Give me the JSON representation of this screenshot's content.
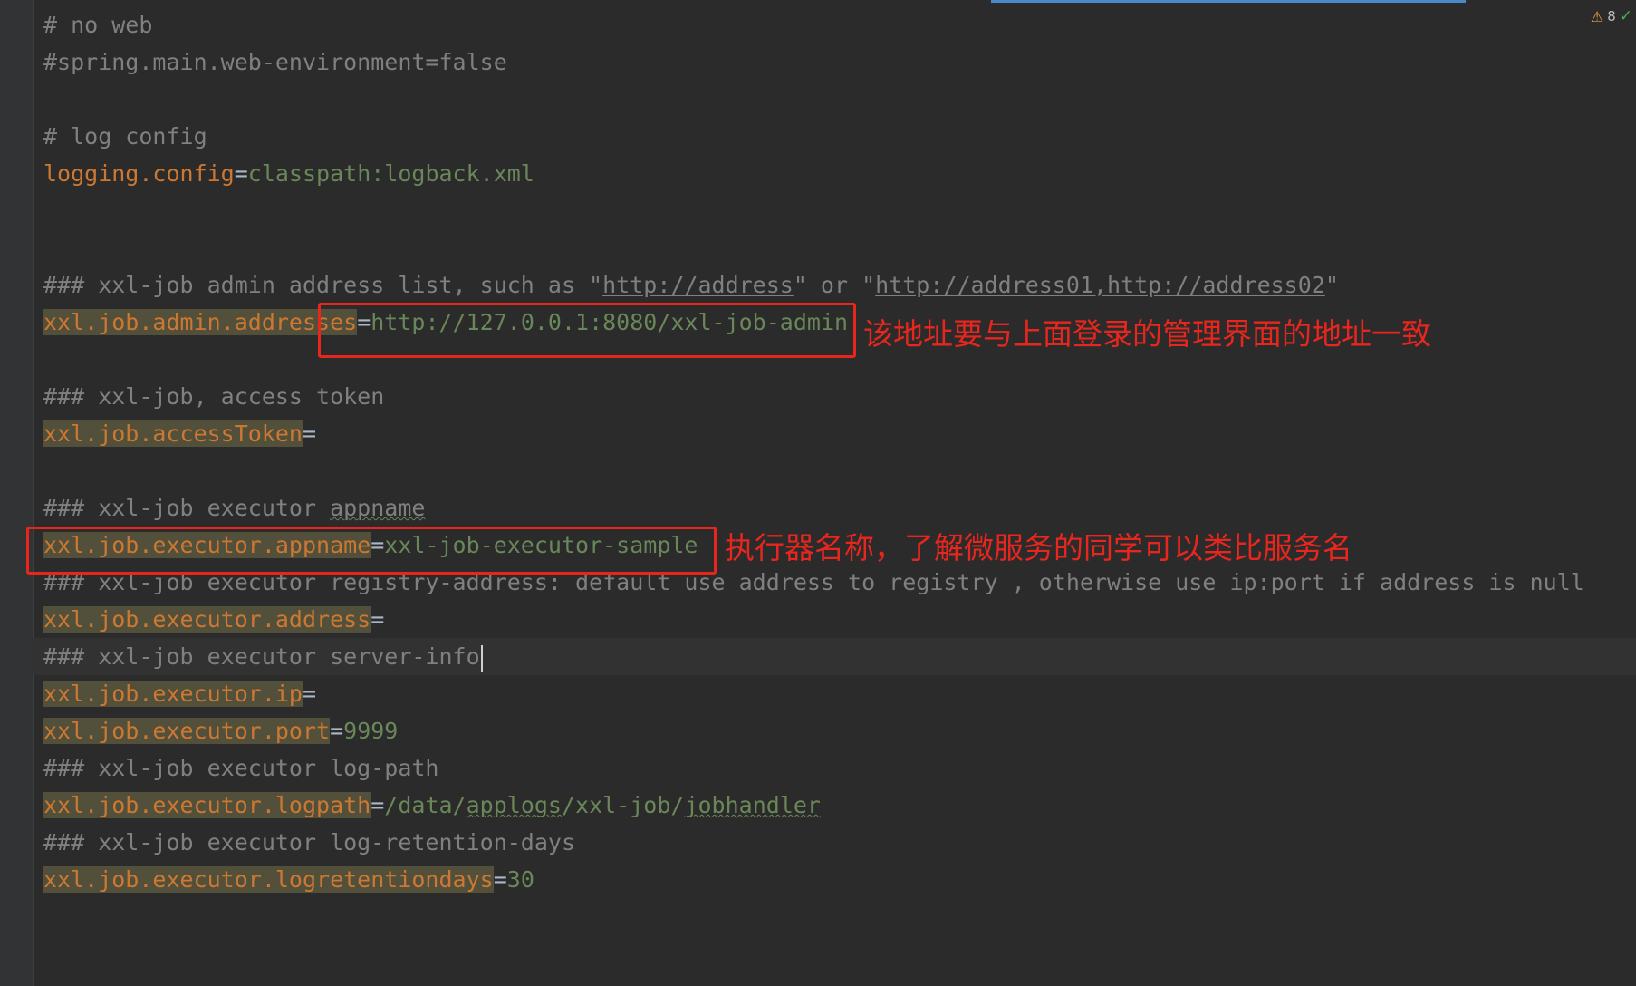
{
  "status": {
    "warning_count": "8"
  },
  "lines": {
    "l1": "# no web",
    "l2": "#spring.main.web-environment=false",
    "l3": "# log config",
    "l4": {
      "key": "logging.config",
      "eq": "=",
      "value": "classpath:logback.xml"
    },
    "l5": {
      "prefix": "### xxl-job admin address list, such as \"",
      "link1": "http://address",
      "mid": "\" or \"",
      "link2": "http://address01,http://address02",
      "suffix": "\""
    },
    "l6": {
      "key": "xxl.job.admin.addresses",
      "eq": "=",
      "value": "http://127.0.0.1:8080/xxl-job-admin"
    },
    "l7": "### xxl-job, access token",
    "l8": {
      "key": "xxl.job.accessToken",
      "eq": "="
    },
    "l9": {
      "prefix": "### xxl-job executor ",
      "word": "appname"
    },
    "l10": {
      "key": "xxl.job.executor.appname",
      "eq": "=",
      "value": "xxl-job-executor-sample"
    },
    "l11": "### xxl-job executor registry-address: default use address to registry , otherwise use ip:port if address is null",
    "l12": {
      "key": "xxl.job.executor.address",
      "eq": "="
    },
    "l13": "### xxl-job executor server-info",
    "l14": {
      "key": "xxl.job.executor.ip",
      "eq": "="
    },
    "l15": {
      "key": "xxl.job.executor.port",
      "eq": "=",
      "value": "9999"
    },
    "l16": "### xxl-job executor log-path",
    "l17": {
      "key": "xxl.job.executor.logpath",
      "eq": "=",
      "v1": "/data/",
      "v2": "applogs",
      "v3": "/xxl-job/",
      "v4": "jobhandler"
    },
    "l18": "### xxl-job executor log-retention-days",
    "l19": {
      "key": "xxl.job.executor.logretentiondays",
      "eq": "=",
      "value": "30"
    }
  },
  "annotations": {
    "admin_note": "该地址要与上面登录的管理界面的地址一致",
    "appname_note": "执行器名称，了解微服务的同学可以类比服务名"
  },
  "colors": {
    "background": "#2b2b2b",
    "comment": "#808080",
    "key": "#cc7832",
    "value": "#6a8759",
    "annotation": "#e8261d"
  }
}
